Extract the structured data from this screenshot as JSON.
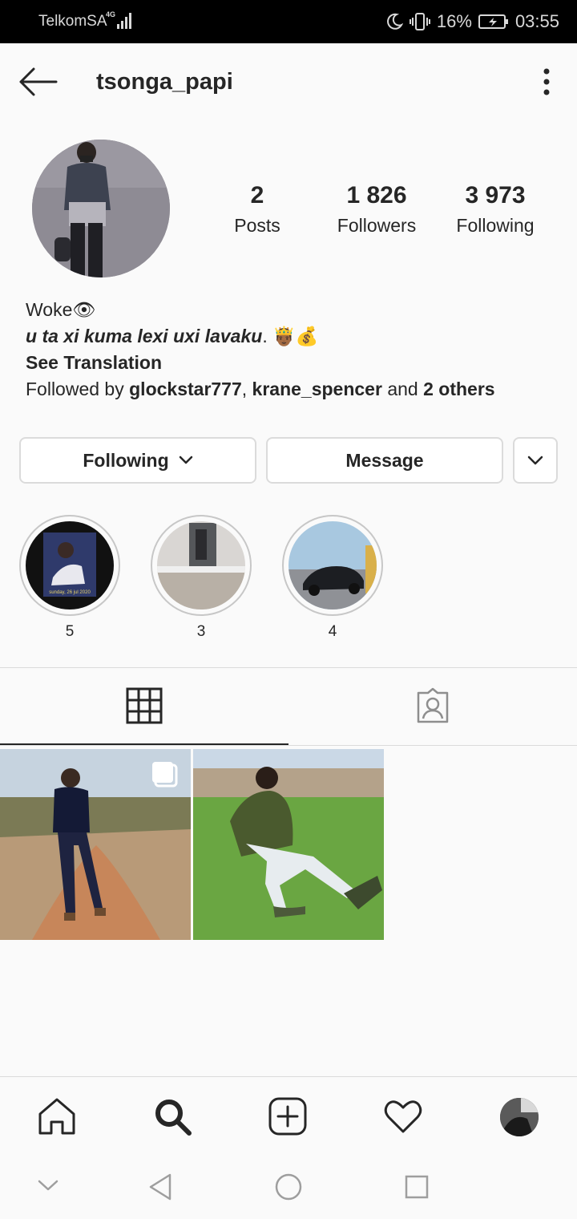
{
  "status_bar": {
    "carrier": "TelkomSA",
    "network": "4G",
    "battery": "16%",
    "time": "03:55"
  },
  "header": {
    "username": "tsonga_papi"
  },
  "stats": [
    {
      "value": "2",
      "label": "Posts"
    },
    {
      "value": "1 826",
      "label": "Followers"
    },
    {
      "value": "3 973",
      "label": "Following"
    }
  ],
  "bio": {
    "name": "Woke",
    "name_emoji": "👁",
    "line": "u ta xi kuma lexi uxi lavaku",
    "line_emoji": "🤴🏾💰",
    "see_translation": "See Translation",
    "followed_by_prefix": "Followed by",
    "followed_user1": "glockstar777",
    "followed_user2": "krane_spencer",
    "followed_and": "and",
    "followed_others": "2 others"
  },
  "actions": {
    "following": "Following",
    "message": "Message"
  },
  "highlights": [
    {
      "label": "5"
    },
    {
      "label": "3"
    },
    {
      "label": "4"
    }
  ],
  "highlight1_caption": "sunday, 26 jul 2020"
}
